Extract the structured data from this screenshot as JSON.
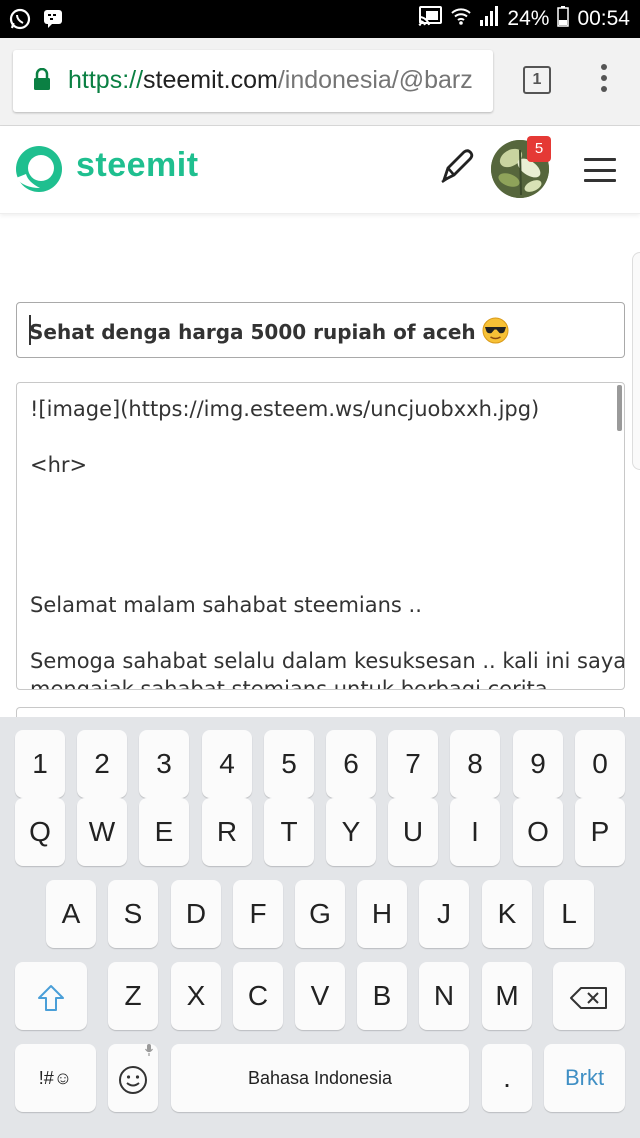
{
  "status_bar": {
    "battery": "24%",
    "time": "00:54"
  },
  "browser": {
    "url_scheme": "https://",
    "url_host": "steemit.com",
    "url_path": "/indonesia/@barz",
    "tab_count": "1"
  },
  "site": {
    "logo_text": "steemit",
    "notification_count": "5",
    "brand_color": "#1fbf8f"
  },
  "editor": {
    "title_value": "Sehat denga harga 5000 rupiah of aceh",
    "body_lines": [
      "![image](https://img.esteem.ws/uncjuobxxh.jpg)",
      "<hr>",
      "Selamat malam sahabat steemians ..",
      "Semoga sahabat selalu dalam kesuksesan .. kali ini saya",
      "mengajak sahabat stemians untuk berbagi cerita"
    ]
  },
  "keyboard": {
    "row_numbers": [
      "1",
      "2",
      "3",
      "4",
      "5",
      "6",
      "7",
      "8",
      "9",
      "0"
    ],
    "row_1": [
      "Q",
      "W",
      "E",
      "R",
      "T",
      "Y",
      "U",
      "I",
      "O",
      "P"
    ],
    "row_2": [
      "A",
      "S",
      "D",
      "F",
      "G",
      "H",
      "J",
      "K",
      "L"
    ],
    "row_3": [
      "Z",
      "X",
      "C",
      "V",
      "B",
      "N",
      "M"
    ],
    "symbols_label": "!#☺",
    "space_label": "Bahasa Indonesia",
    "period_label": ".",
    "enter_label": "Brkt"
  }
}
